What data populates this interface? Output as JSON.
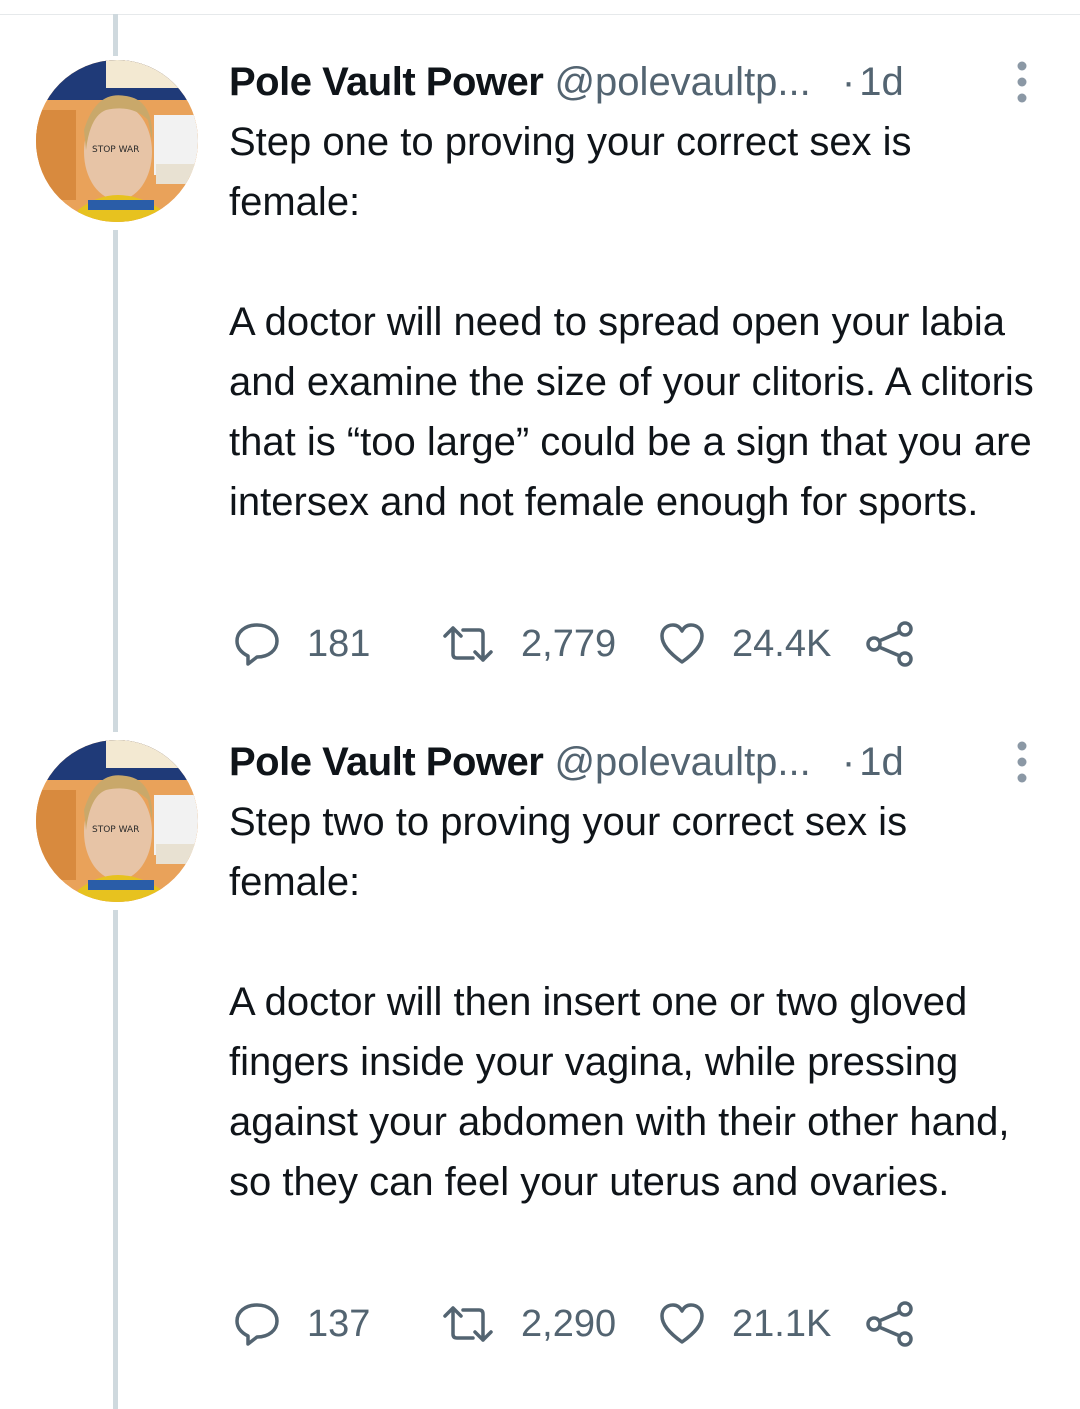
{
  "tweets": [
    {
      "display_name": "Pole Vault Power",
      "handle": "@polevaultp...",
      "dot": "·",
      "time": "1d",
      "text": "Step one to proving your correct sex is female:\n\nA doctor will need to spread open your labia and examine the size of your clitoris. A clitoris that is “too large” could be a sign that you are intersex and not female enough for sports.",
      "replies": "181",
      "retweets": "2,779",
      "likes": "24.4K"
    },
    {
      "display_name": "Pole Vault Power",
      "handle": "@polevaultp...",
      "dot": "·",
      "time": "1d",
      "text": "Step two to proving your correct sex is female:\n\nA doctor will then insert one or two gloved fingers inside your vagina, while pressing against your abdomen with their other hand, so they can feel your uterus and ovaries.",
      "replies": "137",
      "retweets": "2,290",
      "likes": "21.1K"
    }
  ],
  "avatar_sign_text": "STOP WAR"
}
